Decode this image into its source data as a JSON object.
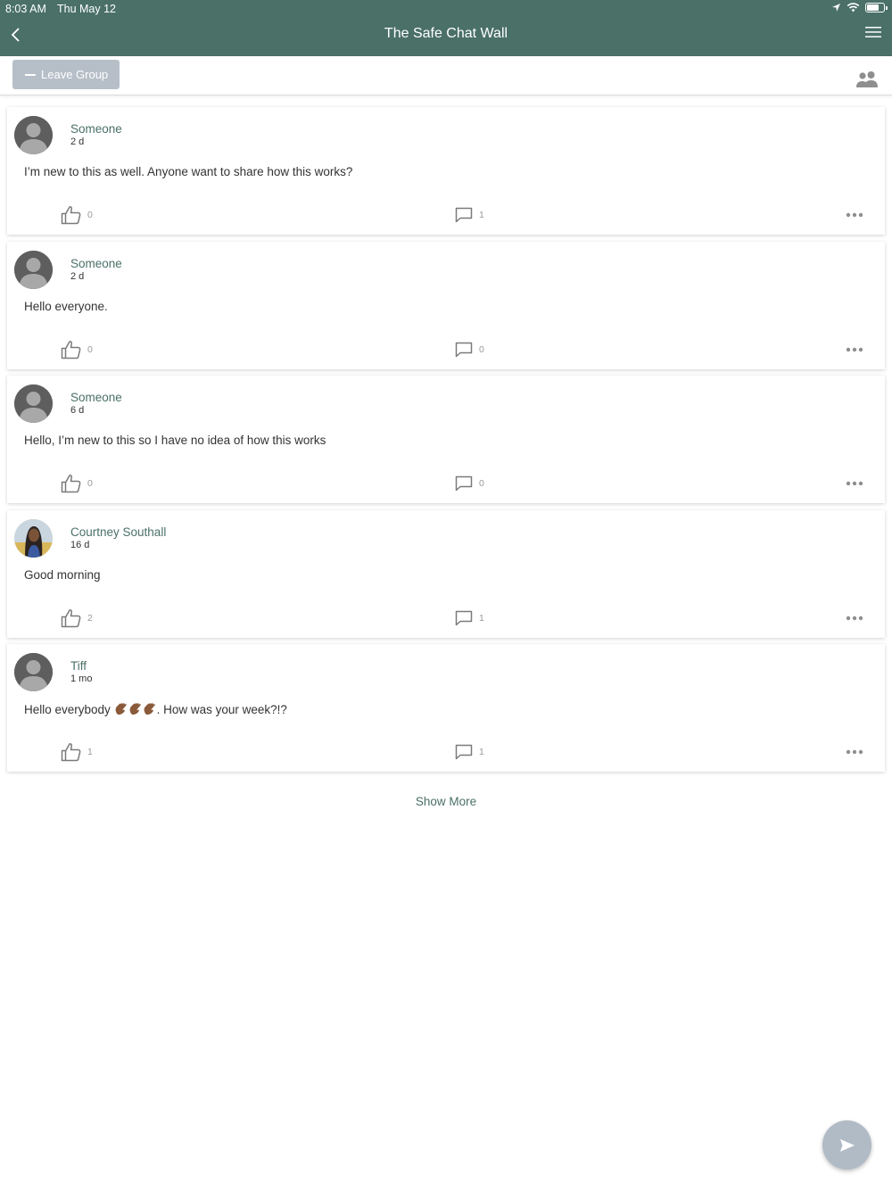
{
  "status_bar": {
    "time": "8:03 AM",
    "date": "Thu May 12",
    "icons": [
      "location-icon",
      "wifi-icon",
      "battery-icon"
    ]
  },
  "nav": {
    "title": "The Safe Chat Wall",
    "back_icon": "chevron-left-icon",
    "menu_icon": "hamburger-menu-icon"
  },
  "toolbar": {
    "leave_label": "Leave Group",
    "members_icon": "group-members-icon"
  },
  "posts": [
    {
      "author": "Someone",
      "age": "2 d",
      "text": "I’m new to this as well. Anyone want to share how this works?",
      "likes": "0",
      "comments": "1",
      "avatar": "default-avatar"
    },
    {
      "author": "Someone",
      "age": "2 d",
      "text": "Hello everyone.",
      "likes": "0",
      "comments": "0",
      "avatar": "default-avatar"
    },
    {
      "author": "Someone",
      "age": "6 d",
      "text": "Hello, I’m new to this so I have no idea of how this works",
      "likes": "0",
      "comments": "0",
      "avatar": "default-avatar"
    },
    {
      "author": "Courtney Southall",
      "age": "16 d",
      "text": "Good morning",
      "likes": "2",
      "comments": "1",
      "avatar": "photo-avatar"
    },
    {
      "author": "Tiff",
      "age": "1 mo",
      "text_before": "Hello everybody ",
      "emoji": "👋🏾👋🏾👋🏾",
      "text_after": ". How was your week?!?",
      "likes": "1",
      "comments": "1",
      "avatar": "default-avatar"
    }
  ],
  "show_more_label": "Show More",
  "fab_icon": "send-icon",
  "colors": {
    "brand": "#4a7068",
    "button_gray": "#b6bfc8",
    "fab": "#b0bbc6",
    "muted": "#9a9a9a"
  }
}
